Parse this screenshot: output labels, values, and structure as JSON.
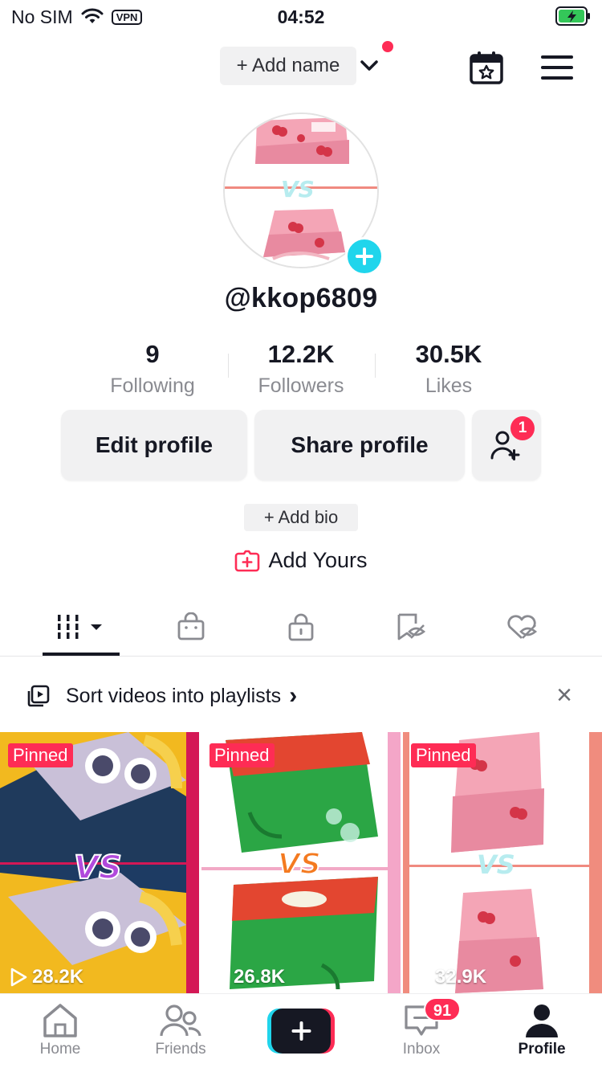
{
  "status_bar": {
    "carrier": "No SIM",
    "vpn": "VPN",
    "time": "04:52"
  },
  "header": {
    "add_name": "+ Add name"
  },
  "profile": {
    "username": "@kkop6809",
    "stats": [
      {
        "value": "9",
        "label": "Following"
      },
      {
        "value": "12.2K",
        "label": "Followers"
      },
      {
        "value": "30.5K",
        "label": "Likes"
      }
    ],
    "edit_profile": "Edit profile",
    "share_profile": "Share profile",
    "friend_badge": "1",
    "add_bio": "+ Add bio",
    "add_yours": "Add Yours"
  },
  "playlist": {
    "text": "Sort videos into playlists",
    "arrow": "›",
    "close": "×"
  },
  "videos": [
    {
      "pinned": "Pinned",
      "views": "28.2K"
    },
    {
      "pinned": "Pinned",
      "views": "26.8K"
    },
    {
      "pinned": "Pinned",
      "views": "32.9K"
    }
  ],
  "bottom_nav": {
    "home": "Home",
    "friends": "Friends",
    "inbox": "Inbox",
    "inbox_badge": "91",
    "profile": "Profile"
  },
  "colors": {
    "accent": "#fe2c55",
    "cyan": "#20d5ec",
    "text": "#161823",
    "muted": "#8a8b91"
  }
}
